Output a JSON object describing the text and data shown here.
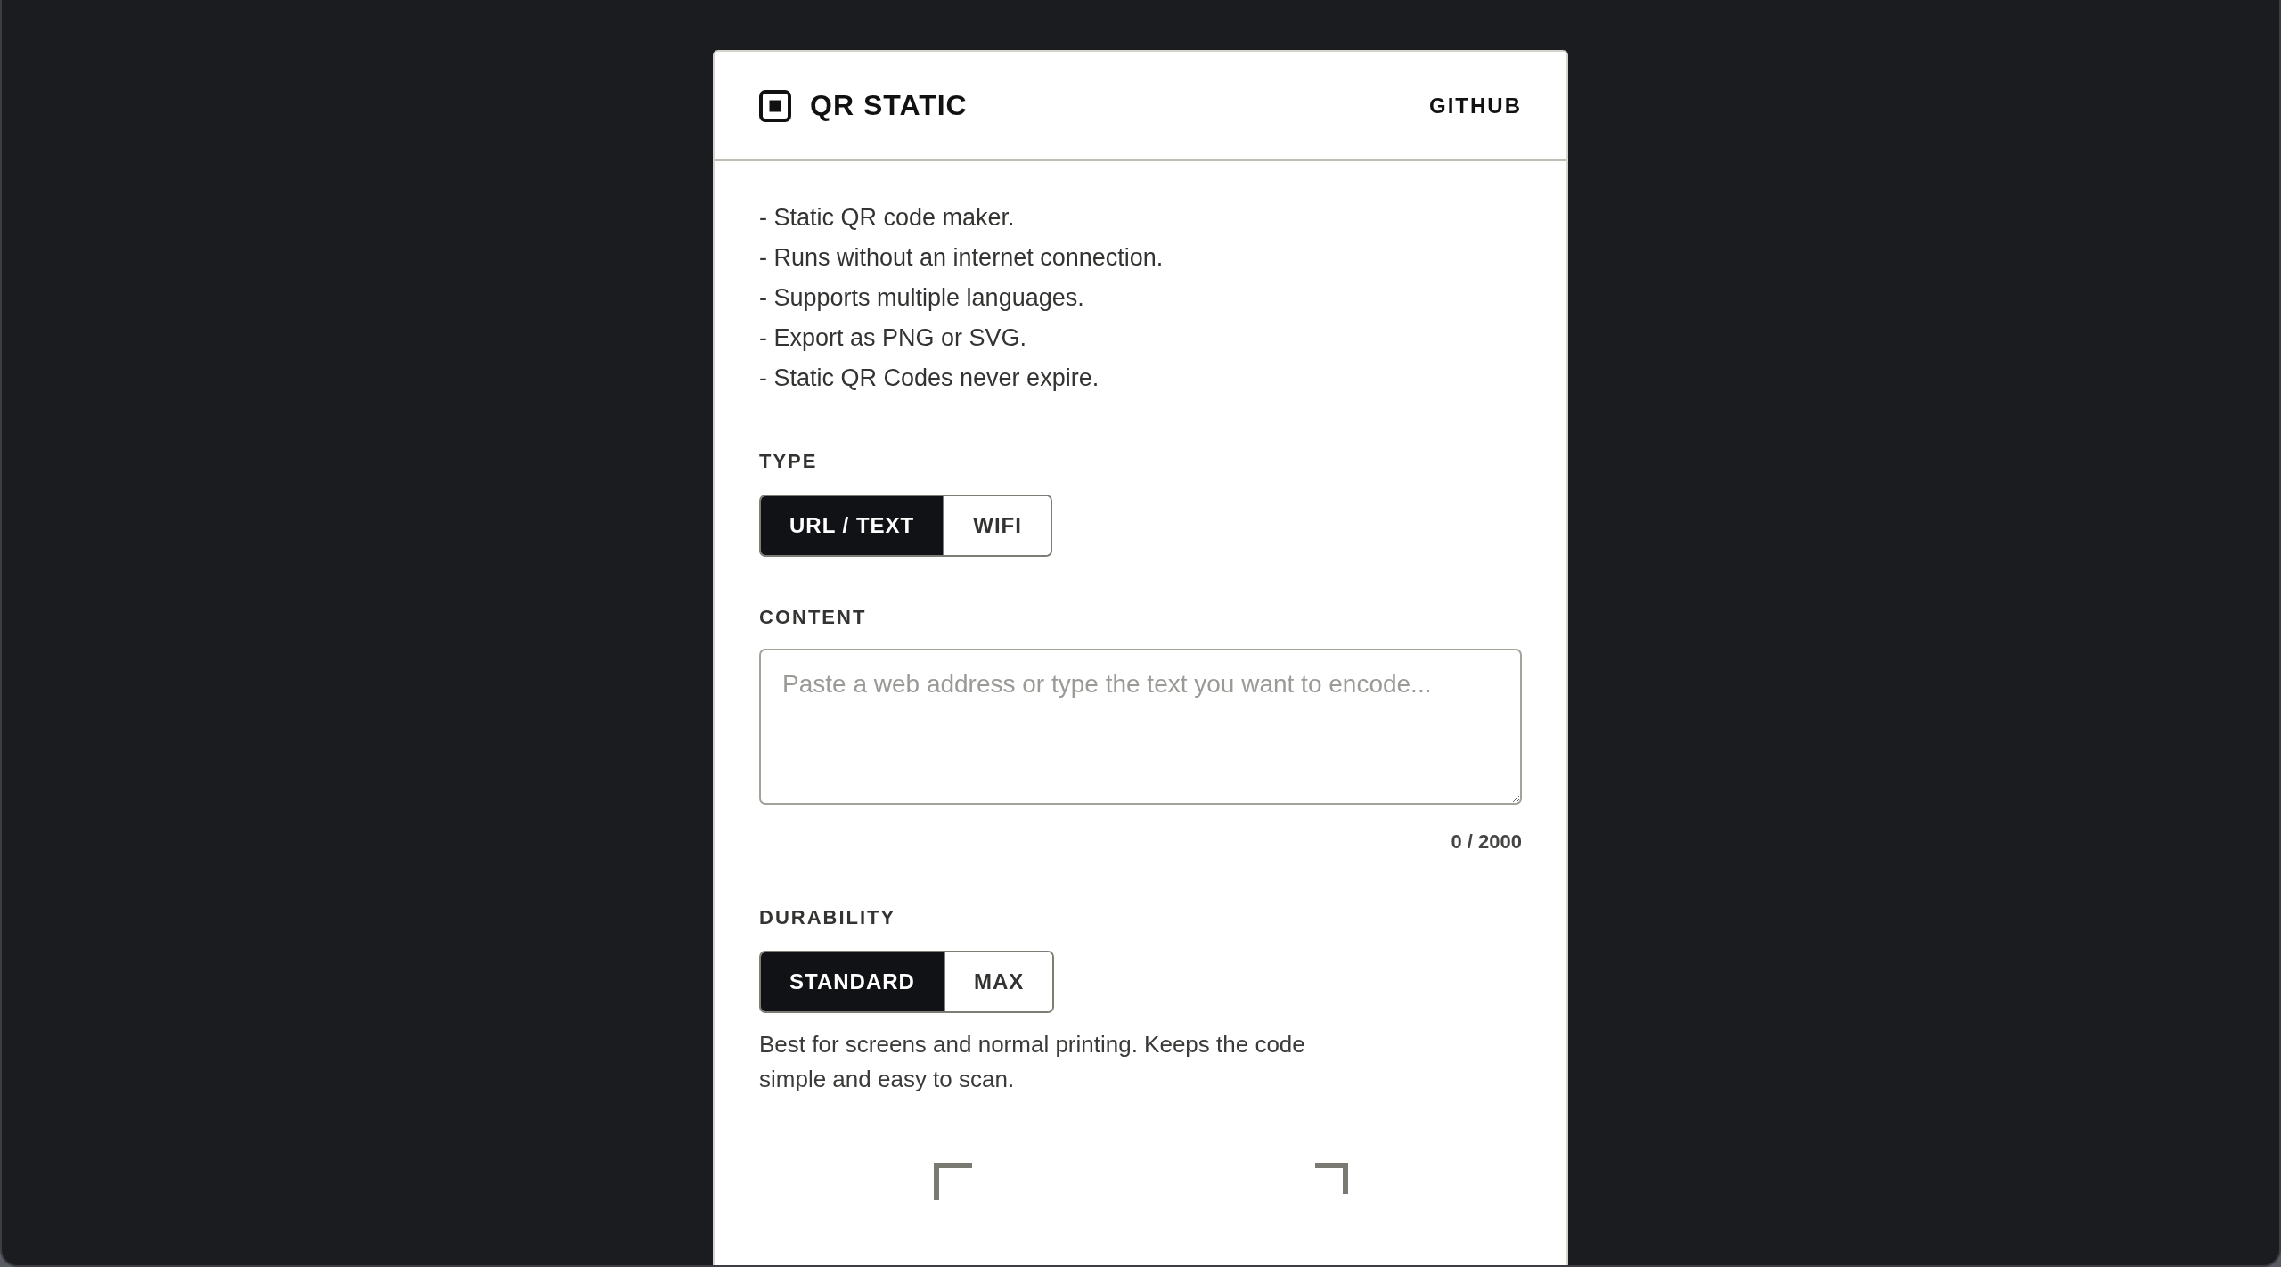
{
  "header": {
    "title": "QR STATIC",
    "link": "GITHUB"
  },
  "features": [
    "- Static QR code maker.",
    "- Runs without an internet connection.",
    "- Supports multiple languages.",
    "- Export as PNG or SVG.",
    "- Static QR Codes never expire."
  ],
  "type": {
    "label": "TYPE",
    "options": [
      {
        "label": "URL / TEXT",
        "selected": true
      },
      {
        "label": "WIFI",
        "selected": false
      }
    ]
  },
  "content": {
    "label": "CONTENT",
    "placeholder": "Paste a web address or type the text you want to encode...",
    "counter": "0 / 2000"
  },
  "durability": {
    "label": "DURABILITY",
    "options": [
      {
        "label": "STANDARD",
        "selected": true
      },
      {
        "label": "MAX",
        "selected": false
      }
    ],
    "description": "Best for screens and normal printing. Keeps the code simple and easy to scan."
  }
}
